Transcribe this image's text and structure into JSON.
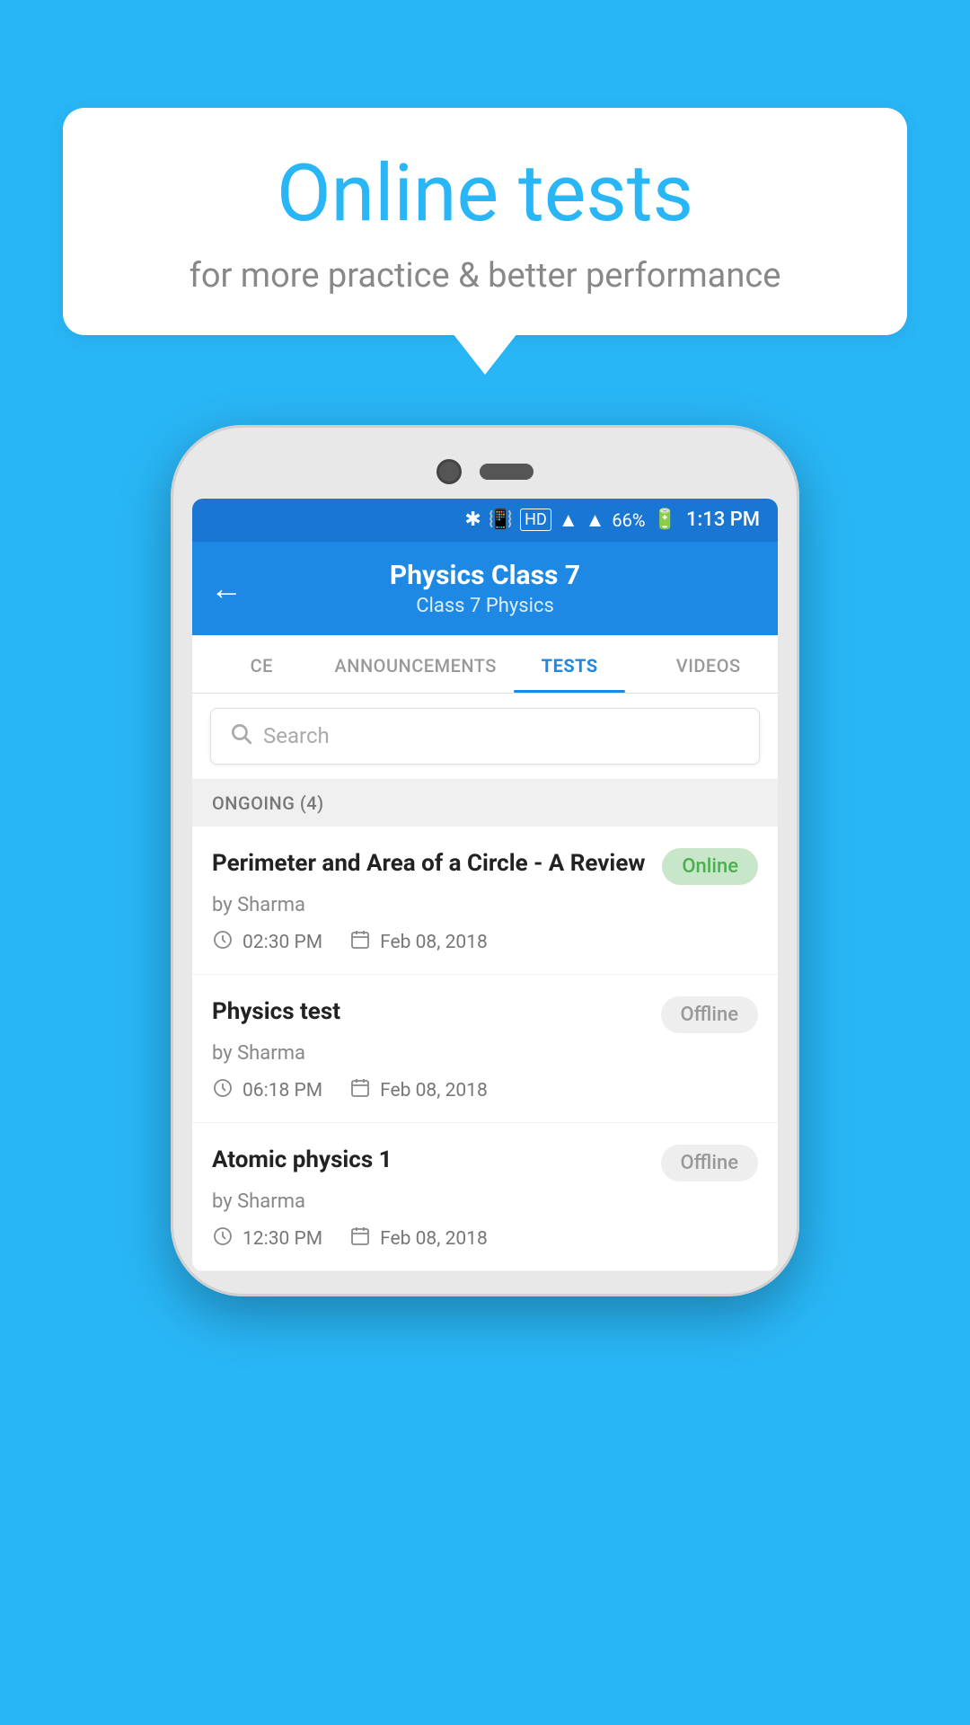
{
  "bubble": {
    "title": "Online tests",
    "subtitle": "for more practice & better performance"
  },
  "status_bar": {
    "battery": "66%",
    "time": "1:13 PM"
  },
  "app_bar": {
    "title": "Physics Class 7",
    "subtitle_class": "Class 7",
    "subtitle_subject": "Physics",
    "back_icon": "←"
  },
  "tabs": [
    {
      "label": "CE",
      "active": false
    },
    {
      "label": "ANNOUNCEMENTS",
      "active": false
    },
    {
      "label": "TESTS",
      "active": true
    },
    {
      "label": "VIDEOS",
      "active": false
    }
  ],
  "search": {
    "placeholder": "Search"
  },
  "section": {
    "label": "ONGOING (4)"
  },
  "tests": [
    {
      "title": "Perimeter and Area of a Circle - A Review",
      "author": "by Sharma",
      "time": "02:30 PM",
      "date": "Feb 08, 2018",
      "badge": "Online",
      "badge_type": "online"
    },
    {
      "title": "Physics test",
      "author": "by Sharma",
      "time": "06:18 PM",
      "date": "Feb 08, 2018",
      "badge": "Offline",
      "badge_type": "offline"
    },
    {
      "title": "Atomic physics 1",
      "author": "by Sharma",
      "time": "12:30 PM",
      "date": "Feb 08, 2018",
      "badge": "Offline",
      "badge_type": "offline"
    }
  ],
  "icons": {
    "clock": "🕐",
    "calendar": "📅"
  }
}
